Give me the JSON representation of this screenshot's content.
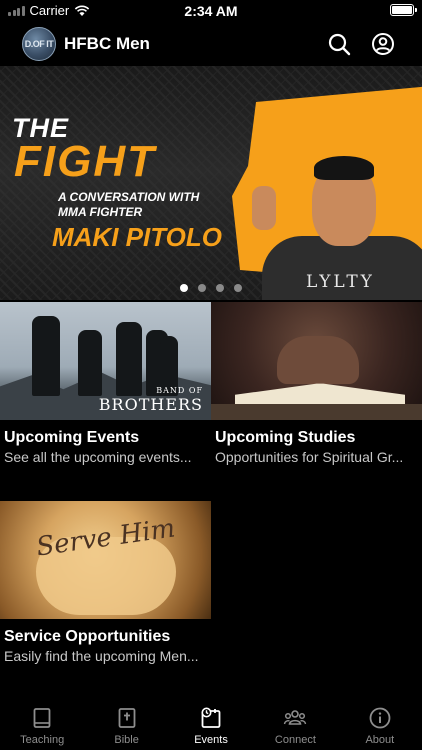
{
  "status_bar": {
    "carrier": "Carrier",
    "time": "2:34 AM"
  },
  "header": {
    "title": "HFBC Men",
    "logo_text": "D.OF IT",
    "search_icon": "search-icon",
    "account_icon": "account-circle-icon"
  },
  "banner": {
    "title_line1": "THE",
    "title_line2": "FIGHT",
    "subtitle": "A CONVERSATION WITH MMA FIGHTER",
    "name": "MAKI PITOLO",
    "shirt_text": "LYLTY",
    "accent_color": "#f6a01a",
    "pages": 4,
    "current_page": 1
  },
  "cards": [
    {
      "title": "Upcoming Events",
      "description": "See all the upcoming events...",
      "image_text_small": "BAND OF",
      "image_text_big": "BROTHERS"
    },
    {
      "title": "Upcoming Studies",
      "description": "Opportunities for Spiritual Gr..."
    },
    {
      "title": "Service Opportunities",
      "description": "Easily find the upcoming Men...",
      "image_text": "Serve Him"
    }
  ],
  "tabs": [
    {
      "label": "Teaching",
      "icon": "book-icon",
      "active": false
    },
    {
      "label": "Bible",
      "icon": "bible-icon",
      "active": false
    },
    {
      "label": "Events",
      "icon": "calendar-icon",
      "active": true
    },
    {
      "label": "Connect",
      "icon": "group-icon",
      "active": false
    },
    {
      "label": "About",
      "icon": "info-icon",
      "active": false
    }
  ]
}
